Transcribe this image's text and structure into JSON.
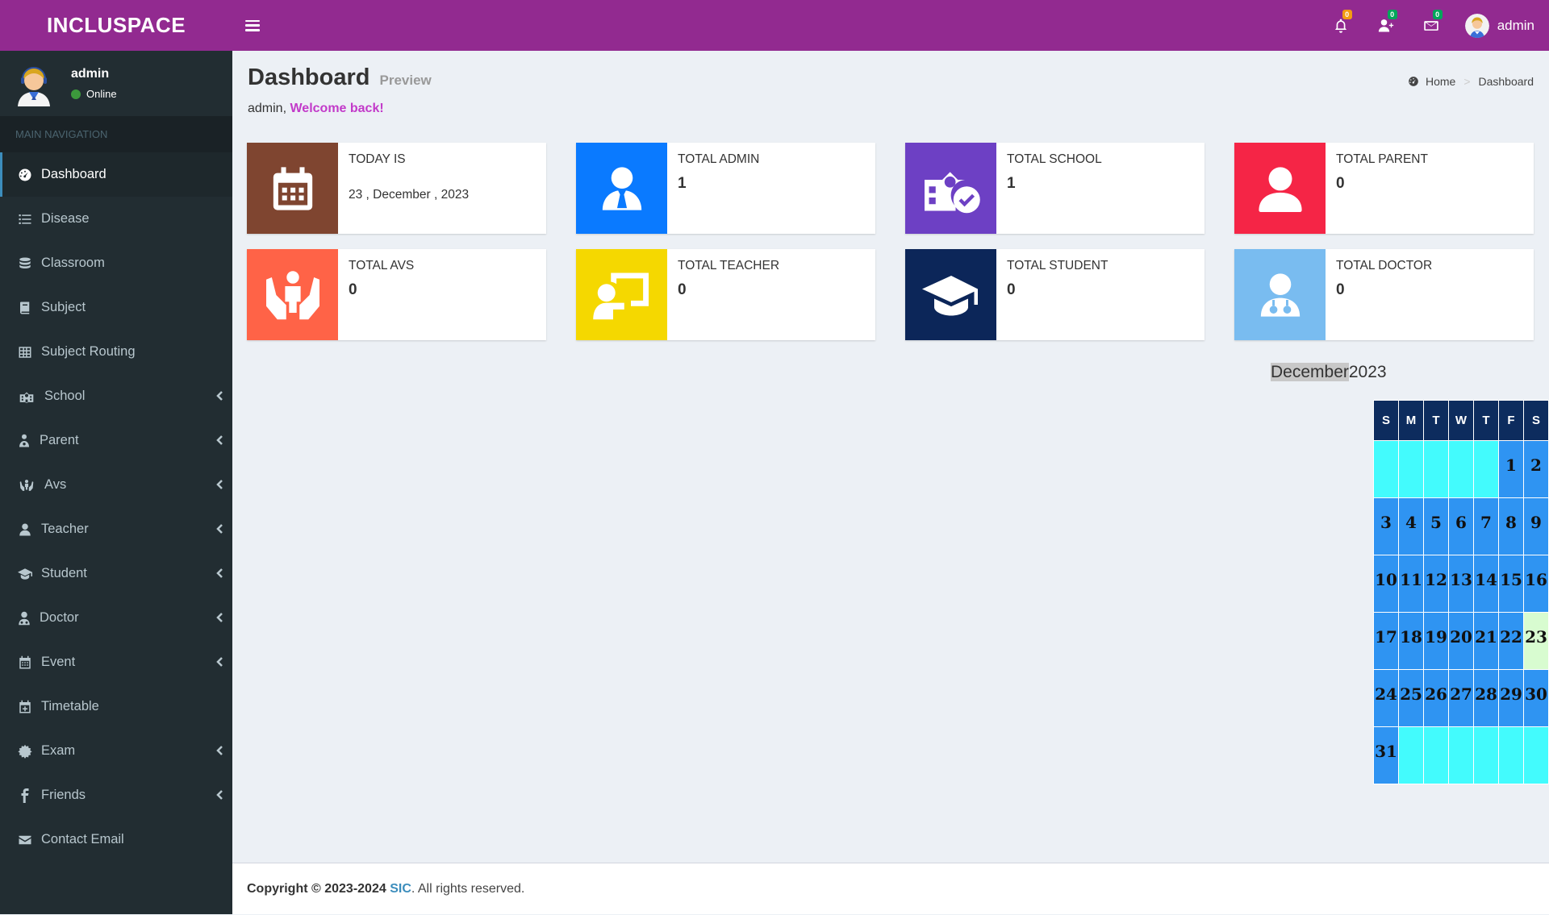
{
  "app": {
    "logo": "INCLUSPACE"
  },
  "header": {
    "notifications_badge": "0",
    "users_badge": "0",
    "messages_badge": "0",
    "user_name": "admin"
  },
  "sidebar": {
    "user_name": "admin",
    "user_status": "Online",
    "nav_header": "MAIN NAVIGATION",
    "items": [
      {
        "label": "Dashboard",
        "icon": "dashboard-icon",
        "active": true
      },
      {
        "label": "Disease",
        "icon": "list-icon"
      },
      {
        "label": "Classroom",
        "icon": "database-icon"
      },
      {
        "label": "Subject",
        "icon": "book-icon"
      },
      {
        "label": "Subject Routing",
        "icon": "table-icon"
      },
      {
        "label": "School",
        "icon": "school-icon",
        "submenu": true
      },
      {
        "label": "Parent",
        "icon": "parent-icon",
        "submenu": true
      },
      {
        "label": "Avs",
        "icon": "hands-icon",
        "submenu": true
      },
      {
        "label": "Teacher",
        "icon": "user-icon",
        "submenu": true
      },
      {
        "label": "Student",
        "icon": "graduation-cap-icon",
        "submenu": true
      },
      {
        "label": "Doctor",
        "icon": "doctor-icon",
        "submenu": true
      },
      {
        "label": "Event",
        "icon": "calendar-icon",
        "submenu": true
      },
      {
        "label": "Timetable",
        "icon": "calendar-plus-icon"
      },
      {
        "label": "Exam",
        "icon": "cog-icon",
        "submenu": true
      },
      {
        "label": "Friends",
        "icon": "facebook-icon",
        "submenu": true
      },
      {
        "label": "Contact Email",
        "icon": "envelope-icon"
      }
    ]
  },
  "page": {
    "title": "Dashboard",
    "subtitle": "Preview",
    "welcome_user": "admin,",
    "welcome_text": "Welcome back!",
    "breadcrumb_home": "Home",
    "breadcrumb_sep": ">",
    "breadcrumb_current": "Dashboard"
  },
  "stats": {
    "today": {
      "label": "TODAY IS",
      "value": "23 , December , 2023",
      "color": "#7f4530"
    },
    "admin": {
      "label": "TOTAL ADMIN",
      "value": "1",
      "color": "#0a7aff"
    },
    "school": {
      "label": "TOTAL SCHOOL",
      "value": "1",
      "color": "#6d40c4"
    },
    "parent": {
      "label": "TOTAL PARENT",
      "value": "0",
      "color": "#f52546"
    },
    "avs": {
      "label": "TOTAL AVS",
      "value": "0",
      "color": "#ff6347"
    },
    "teacher": {
      "label": "TOTAL TEACHER",
      "value": "0",
      "color": "#f5d800"
    },
    "student": {
      "label": "TOTAL STUDENT",
      "value": "0",
      "color": "#0c2659"
    },
    "doctor": {
      "label": "TOTAL DOCTOR",
      "value": "0",
      "color": "#79bcf0"
    }
  },
  "calendar": {
    "month": "December",
    "year": "2023",
    "weekdays": [
      "S",
      "M",
      "T",
      "W",
      "T",
      "F",
      "S"
    ],
    "weeks": [
      [
        "",
        "",
        "",
        "",
        "",
        "1",
        "2"
      ],
      [
        "3",
        "4",
        "5",
        "6",
        "7",
        "8",
        "9"
      ],
      [
        "10",
        "11",
        "12",
        "13",
        "14",
        "15",
        "16"
      ],
      [
        "17",
        "18",
        "19",
        "20",
        "21",
        "22",
        "23"
      ],
      [
        "24",
        "25",
        "26",
        "27",
        "28",
        "29",
        "30"
      ],
      [
        "31",
        "",
        "",
        "",
        "",
        "",
        ""
      ]
    ],
    "today": "23"
  },
  "footer": {
    "copyright": "Copyright © 2023-2024",
    "brand": "SIC",
    "rights": ". All rights reserved."
  }
}
